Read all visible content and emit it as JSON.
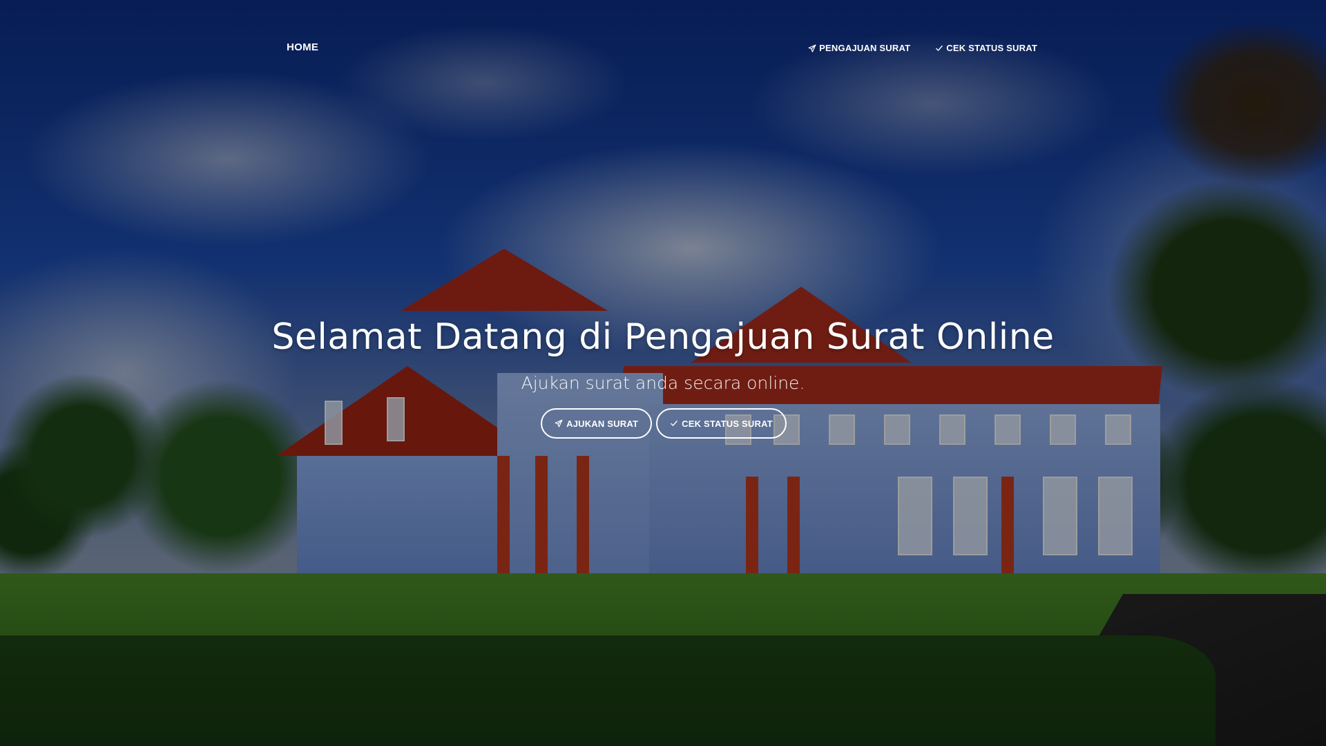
{
  "nav": {
    "brand": "HOME",
    "links": [
      {
        "label": "PENGAJUAN SURAT",
        "icon": "send-icon"
      },
      {
        "label": "CEK STATUS SURAT",
        "icon": "check-icon"
      }
    ]
  },
  "hero": {
    "title": "Selamat Datang di Pengajuan Surat Online",
    "subtitle": "Ajukan surat anda secara online.",
    "buttons": [
      {
        "label": "AJUKAN SURAT",
        "icon": "send-icon"
      },
      {
        "label": "CEK STATUS SURAT",
        "icon": "check-icon"
      }
    ]
  },
  "colors": {
    "text": "#ffffff",
    "overlay": "rgba(0,0,0,0.38)"
  }
}
